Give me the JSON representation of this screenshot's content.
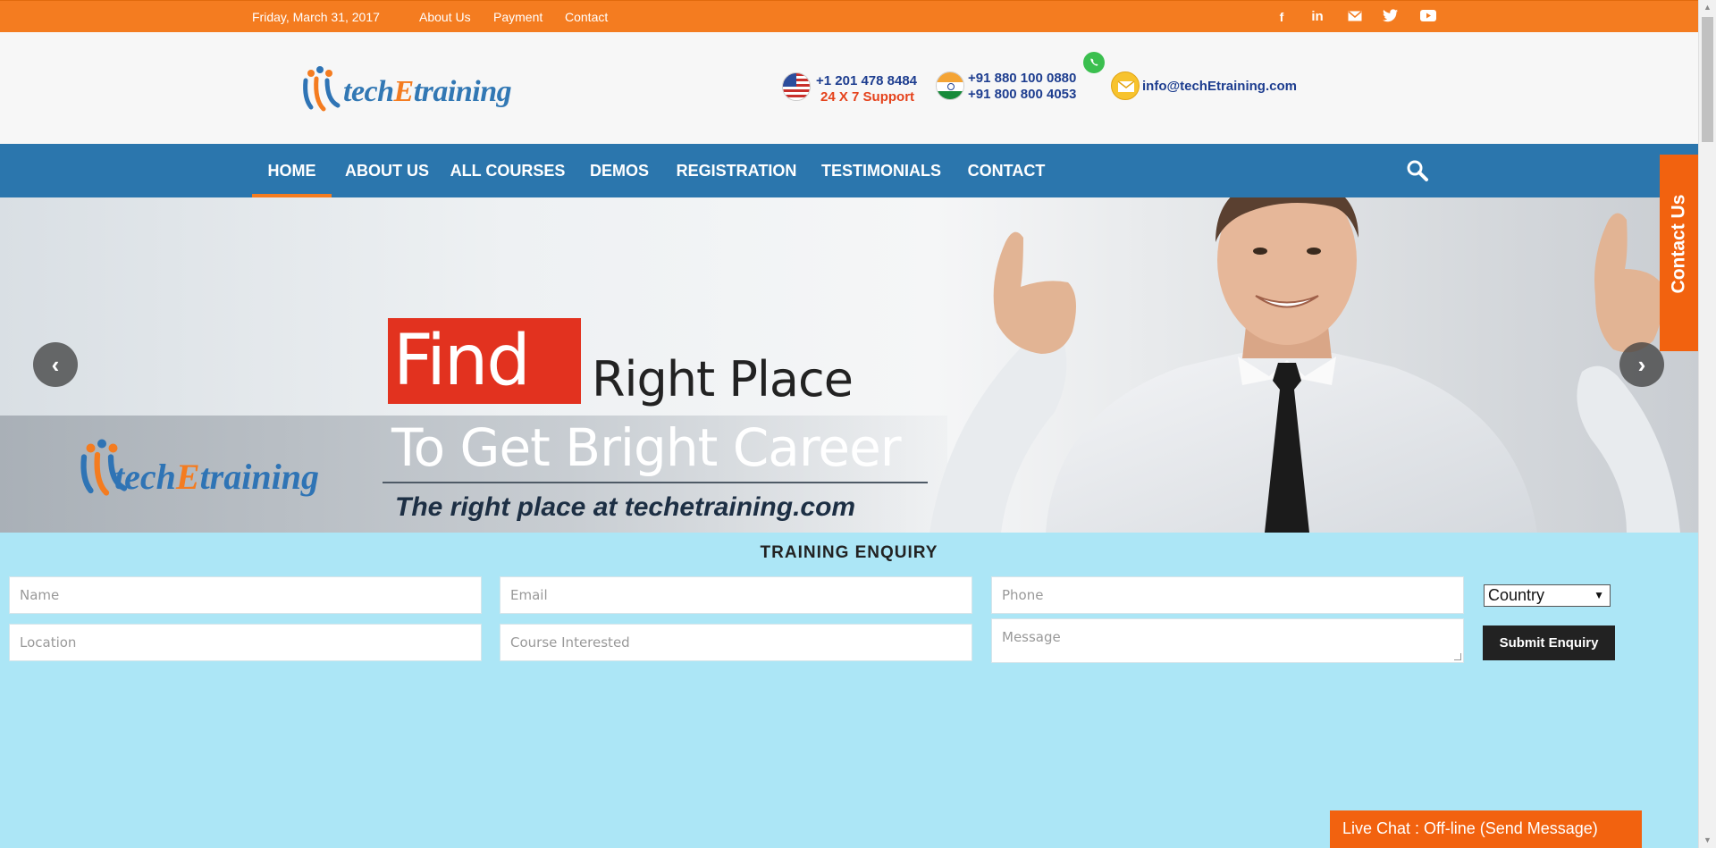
{
  "topbar": {
    "date": "Friday, March 31, 2017",
    "links": [
      "About Us",
      "Payment",
      "Contact"
    ],
    "social_icons": [
      "facebook-icon",
      "linkedin-icon",
      "mail-icon",
      "twitter-icon",
      "youtube-icon"
    ]
  },
  "header": {
    "logo_prefix": "tech",
    "logo_e": "E",
    "logo_suffix": "training",
    "us_phone": "+1 201 478 8484",
    "support": "24 X 7 Support",
    "india_phone_1": "+91 880 100 0880",
    "india_phone_2": "+91 800 800 4053",
    "email": "info@techEtraining.com"
  },
  "nav": {
    "items": [
      "HOME",
      "ABOUT US",
      "ALL COURSES",
      "DEMOS",
      "REGISTRATION",
      "TESTIMONIALS",
      "CONTACT"
    ]
  },
  "hero": {
    "find": "Find",
    "right_place": "Right Place",
    "bright_career": "To Get Bright Career",
    "url_line": "The right place at techetraining.com",
    "logo_prefix": "tech",
    "logo_e": "E",
    "logo_suffix": "training"
  },
  "side_tab": {
    "label": "Contact Us"
  },
  "enquiry": {
    "title": "TRAINING ENQUIRY",
    "name_placeholder": "Name",
    "email_placeholder": "Email",
    "phone_placeholder": "Phone",
    "country_value": "Country",
    "location_placeholder": "Location",
    "course_placeholder": "Course Interested",
    "message_placeholder": "Message",
    "submit_label": "Submit Enquiry"
  },
  "livechat": {
    "label": "Live Chat : Off-line (Send Message)"
  },
  "colors": {
    "accent": "#f47c20",
    "nav": "#2b76ad",
    "form_bg": "#ace6f6"
  }
}
